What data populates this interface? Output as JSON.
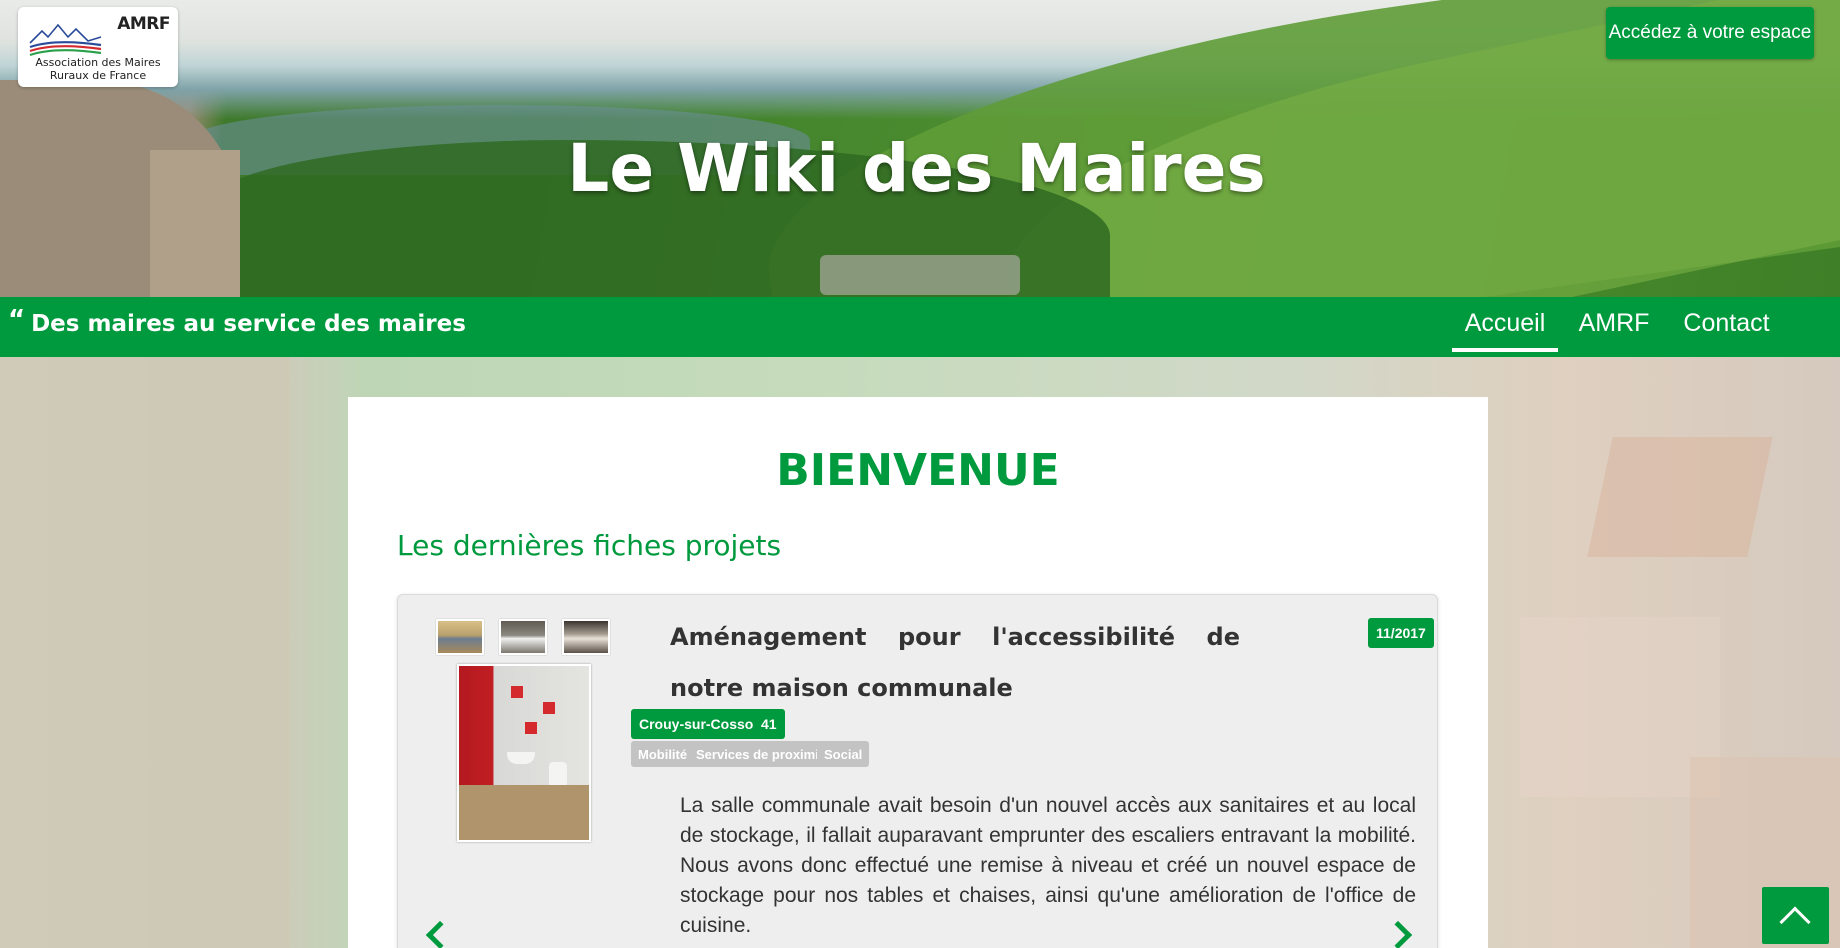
{
  "header": {
    "logo": {
      "abbr": "AMRF",
      "name_line1": "Association des Maires",
      "name_line2": "Ruraux de France"
    },
    "space_button": "Accédez à votre espace",
    "site_title": "Le Wiki des Maires"
  },
  "navbar": {
    "quote_mark": "“",
    "slogan": "Des maires au service des maires",
    "items": [
      {
        "label": "Accueil",
        "active": true
      },
      {
        "label": "AMRF",
        "active": false
      },
      {
        "label": "Contact",
        "active": false
      }
    ]
  },
  "main": {
    "welcome": "BIENVENUE",
    "section_title": "Les dernières fiches projets",
    "project": {
      "title": "Aménagement pour l'accessibilité de notre maison communale",
      "date": "11/2017",
      "commune": "Crouy-sur-Cosson",
      "department": "41",
      "categories": [
        "Mobilité",
        "Services de proximité",
        "Social"
      ],
      "description": "La salle communale avait besoin d'un nouvel accès aux sanitaires et au local de stockage, il fallait auparavant emprunter des escaliers entravant la mobilité. Nous avons donc effectué une remise à niveau et créé un nouvel espace de stockage pour nos tables et chaises, ainsi qu'une amélioration de l'office de cuisine."
    }
  },
  "colors": {
    "brand_green": "#009a3e",
    "category_gray": "#c3c3c3"
  },
  "icons": {
    "prev": "chevron-left-icon",
    "next": "chevron-right-icon",
    "back_to_top": "chevron-up-icon"
  }
}
